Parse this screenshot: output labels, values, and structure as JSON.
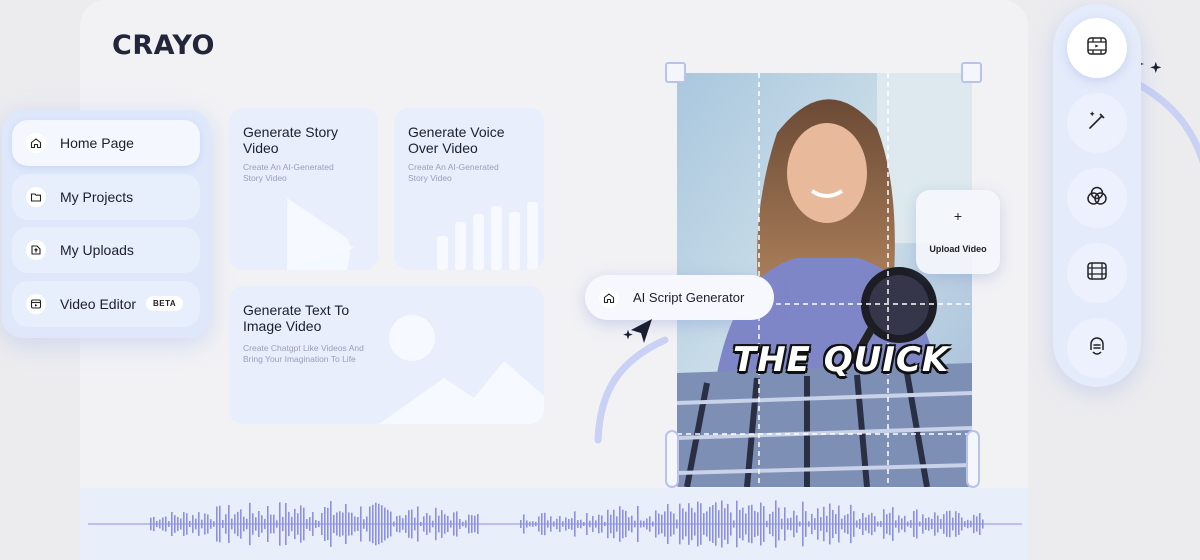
{
  "brand": {
    "logo_text": "CRAYO"
  },
  "sidebar": {
    "items": [
      {
        "label": "Home Page",
        "icon": "home-icon",
        "active": true
      },
      {
        "label": "My Projects",
        "icon": "folder-icon",
        "active": false
      },
      {
        "label": "My Uploads",
        "icon": "upload-icon",
        "active": false
      },
      {
        "label": "Video Editor",
        "icon": "video-editor-icon",
        "active": false,
        "badge": "BETA"
      }
    ]
  },
  "cards": [
    {
      "title": "Generate Story Video",
      "description": "Create An AI-Generated Story Video",
      "icon": "play-icon"
    },
    {
      "title": "Generate Voice Over Video",
      "description": "Create An AI-Generated Story Video",
      "icon": "bars-icon"
    },
    {
      "title": "Generate Text To Image Video",
      "description": "Create Chatgpt Like Videos And Bring Your Imagination To Life",
      "icon": "image-icon"
    }
  ],
  "editor": {
    "caption": "THE QUICK",
    "upload": {
      "plus": "+",
      "label": "Upload Video"
    },
    "script_pill": {
      "label": "AI Script Generator",
      "icon": "home-icon"
    }
  },
  "tool_rail": {
    "items": [
      {
        "icon": "film-frame-icon",
        "active": true
      },
      {
        "icon": "magic-wand-icon",
        "active": false
      },
      {
        "icon": "color-circles-icon",
        "active": false
      },
      {
        "icon": "film-strip-icon",
        "active": false
      },
      {
        "icon": "microphone-icon",
        "active": false
      }
    ]
  },
  "colors": {
    "accent": "#7b85e0",
    "panel": "#f2f2f5",
    "card": "#e8eefc",
    "waveform": "#8a90e6"
  }
}
